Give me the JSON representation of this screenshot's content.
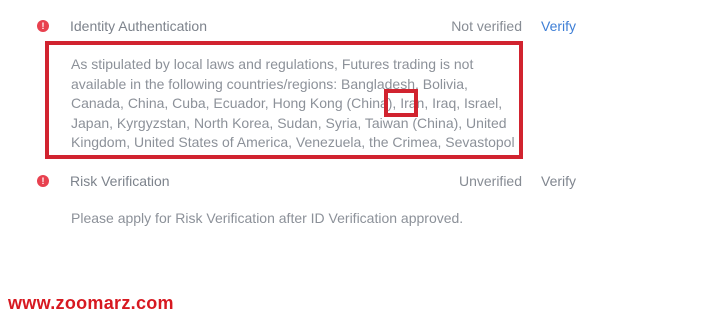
{
  "identity": {
    "icon": "alert-icon",
    "title": "Identity Authentication",
    "status": "Not verified",
    "action": "Verify",
    "notice": "As stipulated by local laws and regulations, Futures trading is not available in the following countries/regions: Bangladesh, Bolivia, Canada, China, Cuba, Ecuador, Hong Kong (China), Iran, Iraq, Israel, Japan, Kyrgyzstan, North Korea, Sudan, Syria, Taiwan (China), United Kingdom, United States of America, Venezuela, the Crimea, Sevastopol"
  },
  "risk": {
    "icon": "alert-icon",
    "title": "Risk Verification",
    "status": "Unverified",
    "action": "Verify",
    "note": "Please apply for Risk Verification after ID Verification approved."
  },
  "watermark": "www.zoomarz.com",
  "colors": {
    "alert": "#e8414f",
    "annotation": "#d1232f",
    "link": "#3f7fd6",
    "text": "#8c9199"
  }
}
